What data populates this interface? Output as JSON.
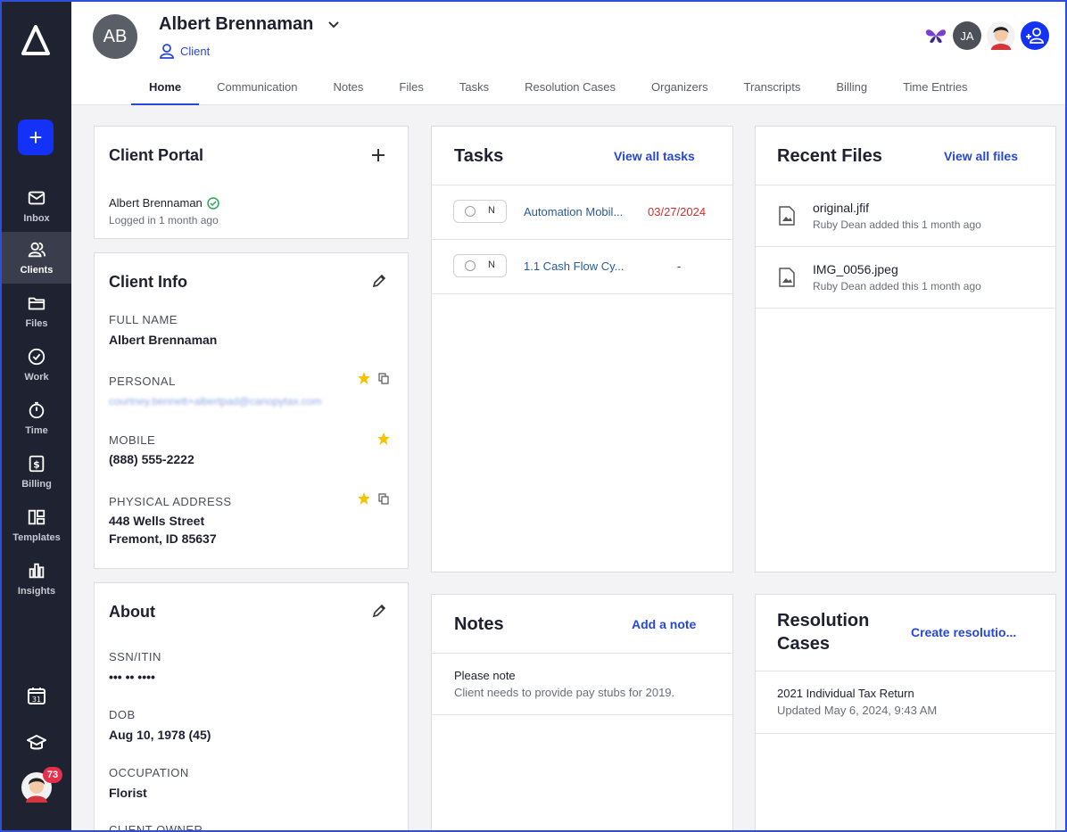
{
  "sidebar": {
    "nav": [
      {
        "label": "Inbox",
        "icon": "envelope-icon"
      },
      {
        "label": "Clients",
        "icon": "users-icon"
      },
      {
        "label": "Files",
        "icon": "folder-icon"
      },
      {
        "label": "Work",
        "icon": "check-circle-icon"
      },
      {
        "label": "Time",
        "icon": "stopwatch-icon"
      },
      {
        "label": "Billing",
        "icon": "dollar-icon"
      },
      {
        "label": "Templates",
        "icon": "layout-icon"
      },
      {
        "label": "Insights",
        "icon": "bar-chart-icon"
      }
    ],
    "active": "Clients",
    "calendar_day": "31",
    "notifications": "73"
  },
  "header": {
    "initials": "AB",
    "name": "Albert Brennaman",
    "role": "Client",
    "tabs": [
      "Home",
      "Communication",
      "Notes",
      "Files",
      "Tasks",
      "Resolution Cases",
      "Organizers",
      "Transcripts",
      "Billing",
      "Time Entries"
    ],
    "active_tab": "Home",
    "team_initials": "JA"
  },
  "client_portal": {
    "title": "Client Portal",
    "user": "Albert Brennaman",
    "status": "Logged in 1 month ago"
  },
  "client_info": {
    "title": "Client Info",
    "full_name_label": "FULL NAME",
    "full_name": "Albert Brennaman",
    "personal_label": "PERSONAL",
    "personal_email": "courtney.bennett+albertpad@canopytax.com",
    "mobile_label": "MOBILE",
    "mobile": "(888) 555-2222",
    "address_label": "PHYSICAL ADDRESS",
    "address_line1": "448 Wells Street",
    "address_line2": "Fremont, ID 85637"
  },
  "about": {
    "title": "About",
    "ssn_label": "SSN/ITIN",
    "ssn": "••• •• ••••",
    "dob_label": "DOB",
    "dob": "Aug 10, 1978 (45)",
    "occupation_label": "OCCUPATION",
    "occupation": "Florist",
    "owner_label": "CLIENT OWNER"
  },
  "tasks": {
    "title": "Tasks",
    "link": "View all tasks",
    "items": [
      {
        "check": "N",
        "name": "Automation Mobil...",
        "due": "03/27/2024"
      },
      {
        "check": "N",
        "name": "1.1 Cash Flow Cy...",
        "due": "-"
      }
    ]
  },
  "recent_files": {
    "title": "Recent Files",
    "link": "View all files",
    "items": [
      {
        "name": "original.jfif",
        "meta": "Ruby Dean added this 1 month ago"
      },
      {
        "name": "IMG_0056.jpeg",
        "meta": "Ruby Dean added this 1 month ago"
      }
    ]
  },
  "notes": {
    "title": "Notes",
    "link": "Add a note",
    "note_title": "Please note",
    "note_body": "Client needs to provide pay stubs for 2019."
  },
  "resolution": {
    "title_line1": "Resolution",
    "title_line2": "Cases",
    "link": "Create resolutio...",
    "case_name": "2021 Individual Tax Return",
    "case_updated": "Updated May 6, 2024, 9:43 AM"
  },
  "colors": {
    "accent": "#2747d8",
    "sidebar": "#1f2230",
    "overdue": "#d0302f",
    "star": "#f5c400",
    "arrow": "#2fd1b0"
  }
}
